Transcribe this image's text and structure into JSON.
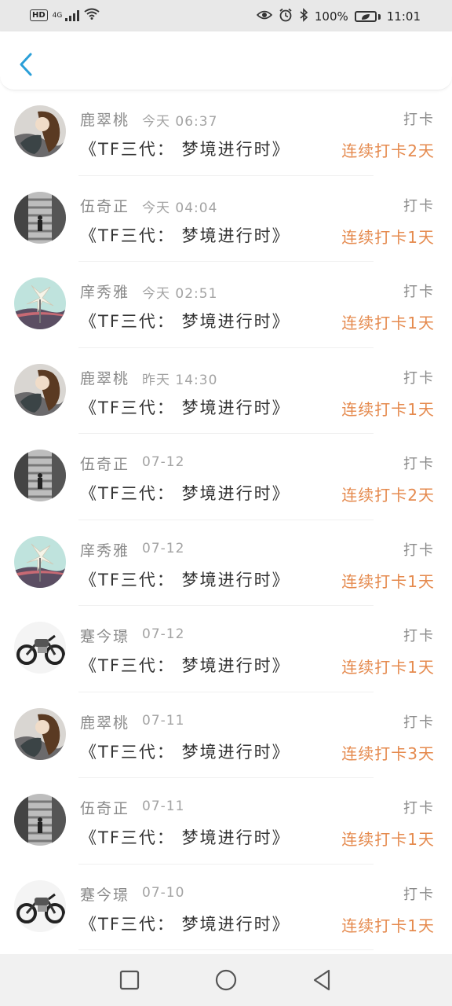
{
  "status_bar": {
    "hd": "HD",
    "network": "4G",
    "battery_percent": "100%",
    "time": "11:01",
    "icons": [
      "signal-icon",
      "wifi-icon",
      "eye-icon",
      "alarm-icon",
      "bluetooth-icon",
      "battery-icon"
    ]
  },
  "header": {
    "back_icon": "chevron-left-icon",
    "accent_color": "#2a9fd8"
  },
  "list": {
    "items": [
      {
        "name": "鹿翠桃",
        "time": "今天 06:37",
        "action": "打卡",
        "book": "《TF三代： 梦境进行时》",
        "streak": "连续打卡2天",
        "avatar": "girl-avatar"
      },
      {
        "name": "伍奇正",
        "time": "今天 04:04",
        "action": "打卡",
        "book": "《TF三代： 梦境进行时》",
        "streak": "连续打卡1天",
        "avatar": "stairs-avatar"
      },
      {
        "name": "庠秀雅",
        "time": "今天 02:51",
        "action": "打卡",
        "book": "《TF三代： 梦境进行时》",
        "streak": "连续打卡1天",
        "avatar": "pinwheel-avatar"
      },
      {
        "name": "鹿翠桃",
        "time": "昨天 14:30",
        "action": "打卡",
        "book": "《TF三代： 梦境进行时》",
        "streak": "连续打卡1天",
        "avatar": "girl-avatar"
      },
      {
        "name": "伍奇正",
        "time": "07-12",
        "action": "打卡",
        "book": "《TF三代： 梦境进行时》",
        "streak": "连续打卡2天",
        "avatar": "stairs-avatar"
      },
      {
        "name": "庠秀雅",
        "time": "07-12",
        "action": "打卡",
        "book": "《TF三代： 梦境进行时》",
        "streak": "连续打卡1天",
        "avatar": "pinwheel-avatar"
      },
      {
        "name": "蹇今璟",
        "time": "07-12",
        "action": "打卡",
        "book": "《TF三代： 梦境进行时》",
        "streak": "连续打卡1天",
        "avatar": "motorcycle-avatar"
      },
      {
        "name": "鹿翠桃",
        "time": "07-11",
        "action": "打卡",
        "book": "《TF三代： 梦境进行时》",
        "streak": "连续打卡3天",
        "avatar": "girl-avatar"
      },
      {
        "name": "伍奇正",
        "time": "07-11",
        "action": "打卡",
        "book": "《TF三代： 梦境进行时》",
        "streak": "连续打卡1天",
        "avatar": "stairs-avatar"
      },
      {
        "name": "蹇今璟",
        "time": "07-10",
        "action": "打卡",
        "book": "《TF三代： 梦境进行时》",
        "streak": "连续打卡1天",
        "avatar": "motorcycle-avatar"
      }
    ],
    "streak_color": "#e58a4e"
  },
  "nav_bar": {
    "icons": [
      "square-icon",
      "circle-icon",
      "triangle-back-icon"
    ]
  }
}
